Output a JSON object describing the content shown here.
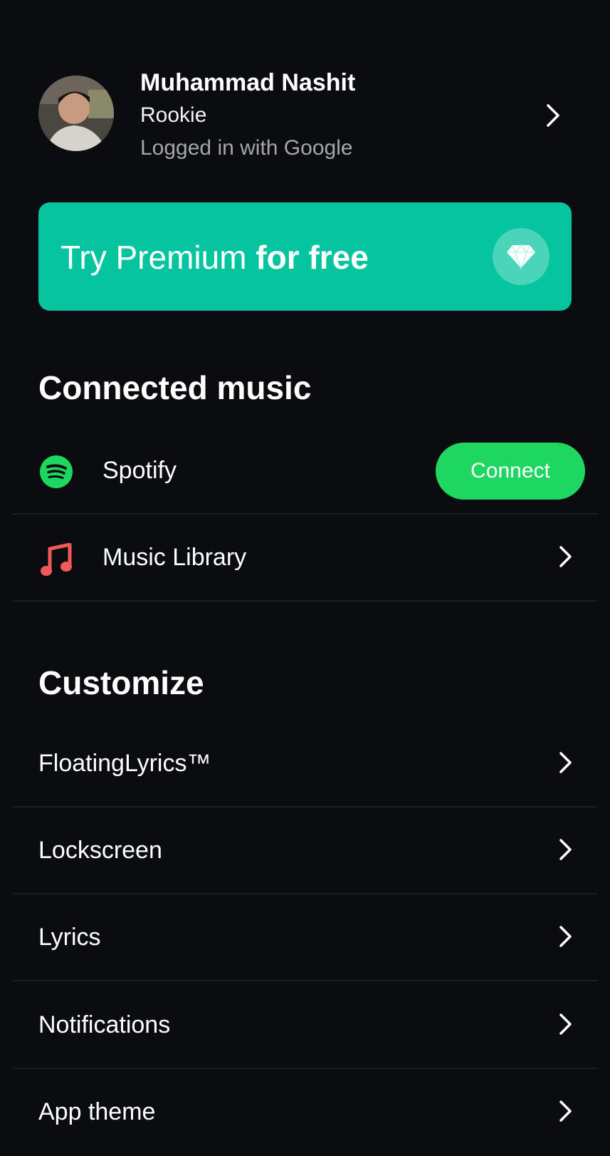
{
  "profile": {
    "name": "Muhammad Nashit",
    "level": "Rookie",
    "login_method": "Logged in with Google"
  },
  "premium": {
    "text_regular": "Try Premium",
    "text_bold": "for free",
    "color": "#05c49e"
  },
  "connected_music": {
    "heading": "Connected music",
    "items": [
      {
        "label": "Spotify",
        "icon": "spotify-icon",
        "action_label": "Connect",
        "action_color": "#1ed760"
      },
      {
        "label": "Music Library",
        "icon": "music-note-icon",
        "icon_color": "#f25a5a"
      }
    ]
  },
  "customize": {
    "heading": "Customize",
    "items": [
      {
        "label": "FloatingLyrics™"
      },
      {
        "label": "Lockscreen"
      },
      {
        "label": "Lyrics"
      },
      {
        "label": "Notifications"
      },
      {
        "label": "App theme"
      }
    ]
  },
  "colors": {
    "background": "#0a0c0f",
    "text_secondary": "#a3a7ad"
  }
}
